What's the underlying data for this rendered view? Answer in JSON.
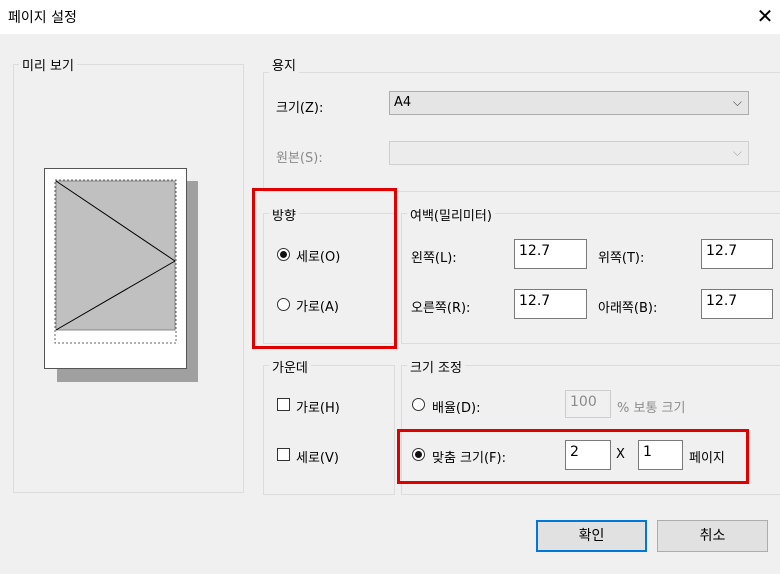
{
  "window": {
    "title": "페이지 설정",
    "close_glyph": "✕"
  },
  "preview": {
    "legend": "미리 보기"
  },
  "paper": {
    "legend": "용지",
    "size_label": "크기(Z):",
    "size_value": "A4",
    "source_label": "원본(S):",
    "source_value": ""
  },
  "orientation": {
    "legend": "방향",
    "portrait_label": "세로(O)",
    "landscape_label": "가로(A)",
    "selected": "portrait"
  },
  "margins": {
    "legend": "여백(밀리미터)",
    "left_label": "왼쪽(L):",
    "left_value": "12.7",
    "right_label": "오른쪽(R):",
    "right_value": "12.7",
    "top_label": "위쪽(T):",
    "top_value": "12.7",
    "bottom_label": "아래쪽(B):",
    "bottom_value": "12.7"
  },
  "centering": {
    "legend": "가운데",
    "horizontal_label": "가로(H)",
    "vertical_label": "세로(V)",
    "horizontal_checked": false,
    "vertical_checked": false
  },
  "scaling": {
    "legend": "크기 조정",
    "adjust_label": "배율(D):",
    "adjust_value": "100",
    "adjust_suffix": "% 보통 크기",
    "fit_label": "맞춤 크기(F):",
    "fit_wide": "2",
    "fit_x": "X",
    "fit_tall": "1",
    "fit_suffix": "페이지",
    "selected": "fit"
  },
  "buttons": {
    "ok": "확인",
    "cancel": "취소"
  },
  "colors": {
    "accent": "#0078d7",
    "highlight": "#e00000"
  }
}
